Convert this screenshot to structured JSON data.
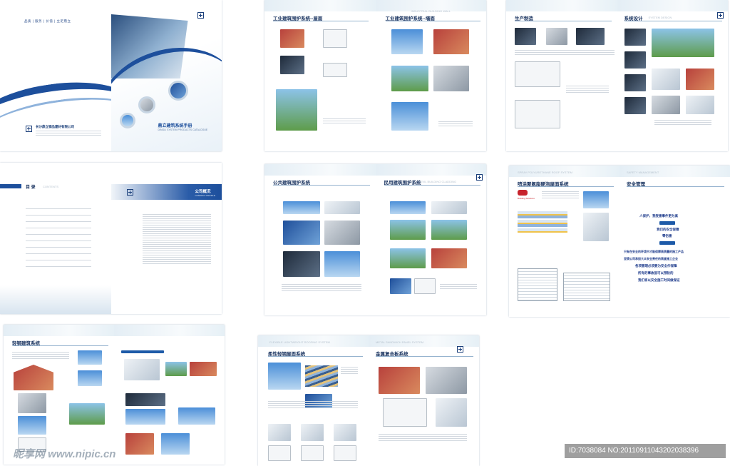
{
  "cover": {
    "tagline": "品质 | 服务 | 价值 | 立足鼎立",
    "company_cn": "长沙鼎立钢品建材有限公司",
    "title": "鼎立建筑系统手册",
    "subtitle_en": "DINGLI SYSTEM PRODUCTS CATALOGUE"
  },
  "toc": {
    "title": "目 录",
    "title_en": "CONTENTS",
    "overview_title": "公司概况",
    "overview_en": "COMPANY PROFILE"
  },
  "roof_wall": {
    "left_title": "工业建筑围护系统--屋面",
    "right_title": "工业建筑围护系统--墙面",
    "right_en": "INDUSTRIAL BUILDING WALL"
  },
  "production": {
    "left_title": "生产制造",
    "right_title": "系统设计",
    "right_en": "SYSTEM DESIGN"
  },
  "public_civil": {
    "left_title": "公共建筑围护系统",
    "right_title": "民用建筑围护系统",
    "right_en": "CIVIL BUILDING CLADDING"
  },
  "spray_safety": {
    "left_title": "喷涂聚氨脂硬泡屋面系统",
    "left_en": "SPRAY POLYURETHANE ROOF SYSTEM",
    "brand": "Building Solutions",
    "right_title": "安全管理",
    "right_en": "SAFETY MANAGEMENT",
    "slogans": [
      "人保护，我受害事件更为高",
      "我们的安全保障",
      "零伤害",
      "只有在安全的环境中才能保障高质量的施工产品",
      "亚硕公司承担大众安全责任的高度施工企业",
      "各项管理必须要为安全作保障",
      "所有的事故皆可以预防的",
      "我们将以安全施工时间做保证"
    ]
  },
  "light_steel": {
    "title": "轻钢建筑系统"
  },
  "flexible_metal": {
    "left_title": "柔性轻钢屋面系统",
    "left_en": "FLEXIBLE LIGHTWEIGHT ROOFING SYSTEM",
    "right_title": "金属复合板系统",
    "right_en": "METAL SANDWICH PANEL SYSTEM"
  },
  "watermark": {
    "left": "昵享网 www.nipic.cn",
    "right": "ID:7038084 NO:20110911043202038396"
  }
}
